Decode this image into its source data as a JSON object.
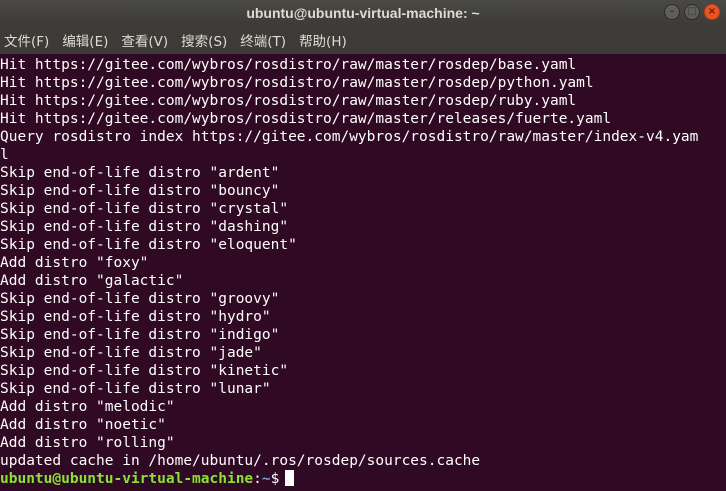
{
  "window": {
    "title": "ubuntu@ubuntu-virtual-machine: ~"
  },
  "menu": [
    "文件(F)",
    "编辑(E)",
    "查看(V)",
    "搜索(S)",
    "终端(T)",
    "帮助(H)"
  ],
  "terminal": {
    "lines": [
      "Hit https://gitee.com/wybros/rosdistro/raw/master/rosdep/base.yaml",
      "Hit https://gitee.com/wybros/rosdistro/raw/master/rosdep/python.yaml",
      "Hit https://gitee.com/wybros/rosdistro/raw/master/rosdep/ruby.yaml",
      "Hit https://gitee.com/wybros/rosdistro/raw/master/releases/fuerte.yaml",
      "Query rosdistro index https://gitee.com/wybros/rosdistro/raw/master/index-v4.yam",
      "l",
      "Skip end-of-life distro \"ardent\"",
      "Skip end-of-life distro \"bouncy\"",
      "Skip end-of-life distro \"crystal\"",
      "Skip end-of-life distro \"dashing\"",
      "Skip end-of-life distro \"eloquent\"",
      "Add distro \"foxy\"",
      "Add distro \"galactic\"",
      "Skip end-of-life distro \"groovy\"",
      "Skip end-of-life distro \"hydro\"",
      "Skip end-of-life distro \"indigo\"",
      "Skip end-of-life distro \"jade\"",
      "Skip end-of-life distro \"kinetic\"",
      "Skip end-of-life distro \"lunar\"",
      "Add distro \"melodic\"",
      "Add distro \"noetic\"",
      "Add distro \"rolling\"",
      "updated cache in /home/ubuntu/.ros/rosdep/sources.cache"
    ],
    "prompt": {
      "user_host": "ubuntu@ubuntu-virtual-machine",
      "separator": ":",
      "path": "~",
      "symbol": "$"
    }
  },
  "colors": {
    "background": "#300a24",
    "prompt_user": "#8ae234",
    "prompt_path": "#729fcf",
    "close_button": "#e95420"
  }
}
